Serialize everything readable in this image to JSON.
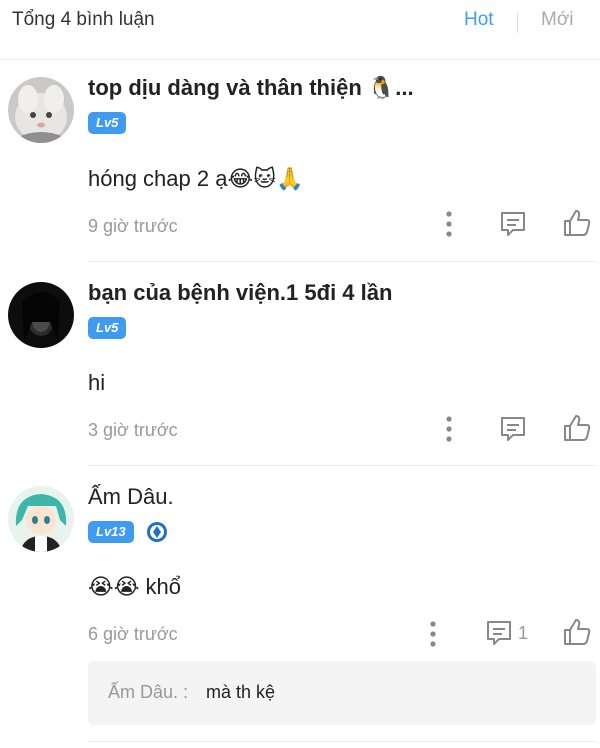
{
  "header": {
    "total_label": "Tổng 4 bình luận",
    "sort_hot": "Hot",
    "sort_new": "Mới",
    "active_color": "#3d9df5"
  },
  "comments": [
    {
      "username": "top dịu dàng và thân thiện 🐧...",
      "level": "Lv5",
      "content": "hóng chap 2 ạ😂🐱🙏",
      "time": "9 giờ trước"
    },
    {
      "username": "bạn của bệnh viện.1 5đi 4 lần",
      "level": "Lv5",
      "content": "hi",
      "time": "3 giờ trước"
    },
    {
      "username": "Ấm Dâu.",
      "level": "Lv13",
      "rank_icon": "blue-shield-icon",
      "content": "😭😭 khổ",
      "time": "6 giờ trước",
      "reply_count": "1",
      "reply": {
        "author": "Ấm Dâu. :",
        "text": "mà th kệ"
      }
    }
  ],
  "icons": {
    "more": "more-vertical-icon",
    "reply": "comment-icon",
    "like": "thumbs-up-icon"
  },
  "colors": {
    "level_badge": "#3f9bf0",
    "muted_text": "#999999",
    "reply_bg": "#f4f4f4"
  }
}
